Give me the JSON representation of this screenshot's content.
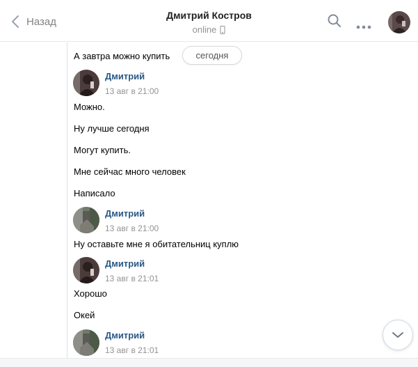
{
  "header": {
    "back_label": "Назад",
    "title": "Дмитрий Костров",
    "status": "online"
  },
  "date_pill": "сегодня",
  "messages": {
    "m0": "А завтра можно купить",
    "g1": {
      "name": "Дмитрий",
      "time": "13 авг в 21:00",
      "lines": [
        "Можно.",
        "Ну лучше сегодня",
        "Могут купить.",
        "Мне сейчас много человек",
        "Написало"
      ]
    },
    "g2": {
      "name": "Дмитрий",
      "time": "13 авг в 21:00",
      "lines": [
        "Ну оставьте мне я обитательниц куплю"
      ]
    },
    "g3": {
      "name": "Дмитрий",
      "time": "13 авг в 21:01",
      "lines": [
        "Хорошо",
        "Окей"
      ]
    },
    "g4": {
      "name": "Дмитрий",
      "time": "13 авг в 21:01"
    }
  },
  "icons": {
    "back": "chevron-left-icon",
    "status": "mobile-phone-icon",
    "search": "search-icon",
    "more": "more-dots-icon",
    "scroll": "chevron-down-icon"
  },
  "colors": {
    "link": "#2a5885",
    "muted": "#939393",
    "border": "#e7e8ec"
  }
}
